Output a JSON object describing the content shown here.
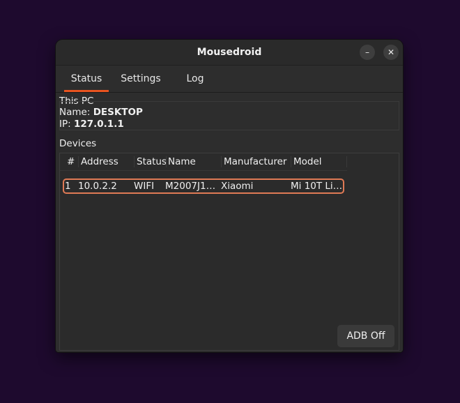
{
  "window": {
    "title": "Mousedroid"
  },
  "tabs": [
    {
      "label": "Status",
      "active": true
    },
    {
      "label": "Settings",
      "active": false
    },
    {
      "label": "Log",
      "active": false
    }
  ],
  "this_pc": {
    "heading": "This PC",
    "name_label": "Name:",
    "name_value": "DESKTOP",
    "ip_label": "IP:",
    "ip_value": "127.0.1.1"
  },
  "devices": {
    "heading": "Devices",
    "columns": [
      "#",
      "Address",
      "Status",
      "Name",
      "Manufacturer",
      "Model"
    ],
    "rows": [
      {
        "index": "1",
        "address": "10.0.2.2",
        "status": "WIFI",
        "name": "M2007J1…",
        "manufacturer": "Xiaomi",
        "model": "Mi 10T Li…"
      }
    ]
  },
  "adb_button": {
    "label": "ADB Off"
  },
  "colors": {
    "accent": "#e95420",
    "selection_border": "#e07a55",
    "background": "#1e0a2e"
  }
}
